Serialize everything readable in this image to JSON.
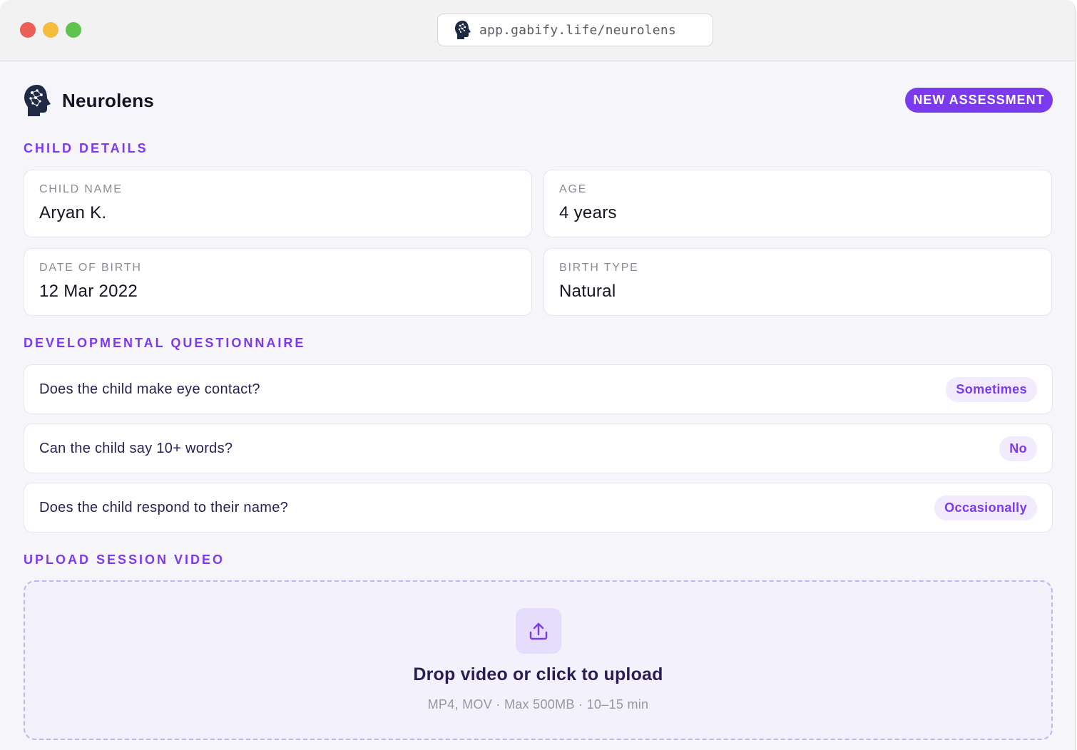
{
  "browser": {
    "url": "app.gabify.life/neurolens"
  },
  "header": {
    "app_name": "Neurolens",
    "new_assessment_label": "NEW ASSESSMENT"
  },
  "child_details": {
    "section_title": "CHILD DETAILS",
    "fields": [
      {
        "label": "CHILD NAME",
        "value": "Aryan K."
      },
      {
        "label": "AGE",
        "value": "4 years"
      },
      {
        "label": "DATE OF BIRTH",
        "value": "12 Mar 2022"
      },
      {
        "label": "BIRTH TYPE",
        "value": "Natural"
      }
    ]
  },
  "questionnaire": {
    "section_title": "DEVELOPMENTAL QUESTIONNAIRE",
    "questions": [
      {
        "question": "Does the child make eye contact?",
        "answer": "Sometimes"
      },
      {
        "question": "Can the child say 10+ words?",
        "answer": "No"
      },
      {
        "question": "Does the child respond to their name?",
        "answer": "Occasionally"
      }
    ]
  },
  "upload": {
    "section_title": "UPLOAD SESSION VIDEO",
    "title": "Drop video or click to upload",
    "subtitle": "MP4, MOV · Max 500MB · 10–15 min",
    "icon": "upload-icon"
  },
  "colors": {
    "accent": "#7c3aed",
    "pill_bg": "#f1ebfd",
    "background": "#f6f5fa",
    "text_dark": "#2b1d52"
  }
}
